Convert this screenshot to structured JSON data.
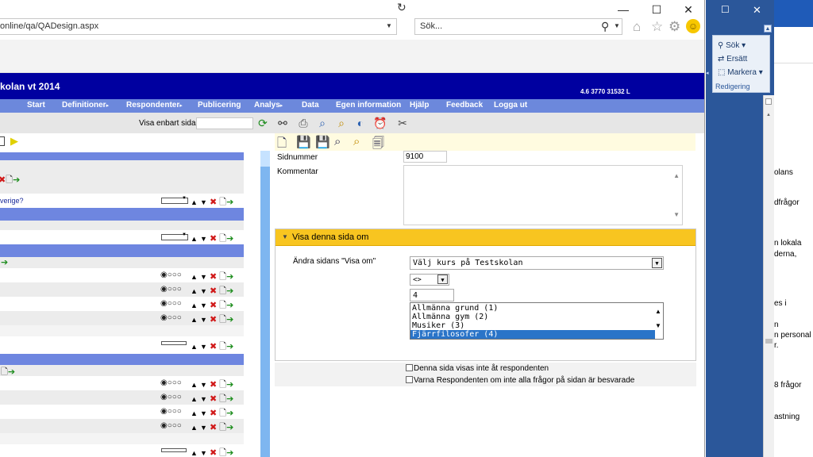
{
  "browser": {
    "address": "online/qa/QADesign.aspx",
    "search_placeholder": "Sök...",
    "window_controls": {
      "minimize": "—",
      "maximize": "☐",
      "close": "✕"
    }
  },
  "app": {
    "title": "kolan vt 2014",
    "version": "4.6 3770 31532 L",
    "menu": [
      {
        "label": "Start",
        "arrow": ""
      },
      {
        "label": "Definitioner",
        "arrow": "▸"
      },
      {
        "label": "Respondenter",
        "arrow": "▸"
      },
      {
        "label": "Publicering",
        "arrow": ""
      },
      {
        "label": "Analys",
        "arrow": "▸"
      },
      {
        "label": "Data",
        "arrow": ""
      },
      {
        "label": "Egen information",
        "arrow": ""
      },
      {
        "label": "Hjälp",
        "arrow": ""
      },
      {
        "label": "Feedback",
        "arrow": ""
      },
      {
        "label": "Logga ut",
        "arrow": ""
      }
    ],
    "show_only_label": "Visa enbart sida",
    "left_question_text": "verige?",
    "radio_group": "◉○○○"
  },
  "form": {
    "sidnummer_label": "Sidnummer",
    "sidnummer_value": "9100",
    "kommentar_label": "Kommentar",
    "section_title": "Visa denna sida om",
    "change_label": "Ändra sidans \"Visa om\"",
    "condition_select": "Välj kurs på Testskolan",
    "operator_select": "<>",
    "value_input": "4",
    "list_options": [
      "Allmänna grund (1)",
      "Allmänna gym (2)",
      "Musiker (3)",
      "Fjärrfilosofer (4)"
    ],
    "selected_option_index": 3,
    "checkbox1": "Denna sida visas inte åt respondenten",
    "checkbox2": "Varna Respondenten om inte alla frågor på sidan är besvarade"
  },
  "word": {
    "ribbon": {
      "sok": "Sök",
      "ersatt": "Ersätt",
      "markera": "Markera",
      "group": "Redigering"
    },
    "doc_lines": [
      "olans",
      "dfrågor",
      "n lokala",
      "derna,",
      "es i",
      "n",
      "n personal",
      "r.",
      "8 frågor",
      "astning"
    ]
  }
}
